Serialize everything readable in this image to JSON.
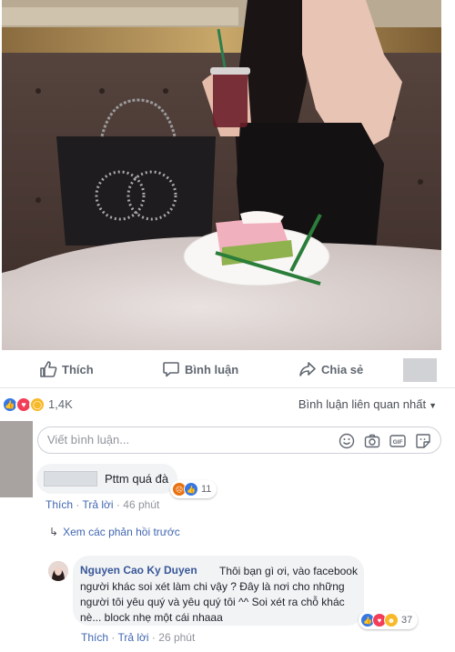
{
  "actions": {
    "like_label": "Thích",
    "comment_label": "Bình luận",
    "share_label": "Chia sẻ"
  },
  "summary": {
    "reaction_count": "1,4K",
    "sort_label": "Bình luận liên quan nhất",
    "reaction_icons": [
      "like-icon",
      "love-icon",
      "wow-icon"
    ]
  },
  "composer": {
    "placeholder": "Viết bình luận...",
    "icons": [
      "emoji-icon",
      "camera-icon",
      "gif-icon",
      "sticker-icon"
    ]
  },
  "comments": [
    {
      "text": "Pttm quá đà",
      "reaction_count": "11",
      "reaction_icons": [
        "angry-icon",
        "like-icon"
      ],
      "like_label": "Thích",
      "reply_label": "Trả lời",
      "time": "46 phút"
    }
  ],
  "view_previous_label": "Xem các phản hồi trước",
  "reply": {
    "author": "Nguyen Cao Ky Duyen",
    "text": "Thôi bạn gì ơi, vào facebook người khác soi xét làm chi vậy ? Đây là nơi cho những người tôi yêu quý và yêu quý tôi ^^ Soi xét ra chỗ khác nè... block nhẹ một cái nhaaa",
    "reaction_count": "37",
    "reaction_icons": [
      "like-icon",
      "love-icon",
      "haha-icon"
    ],
    "like_label": "Thích",
    "reply_label": "Trả lời",
    "time": "26 phút"
  },
  "colors": {
    "link": "#4267b2",
    "name": "#385898",
    "bubble": "#f2f3f5",
    "meta": "#90949c"
  }
}
